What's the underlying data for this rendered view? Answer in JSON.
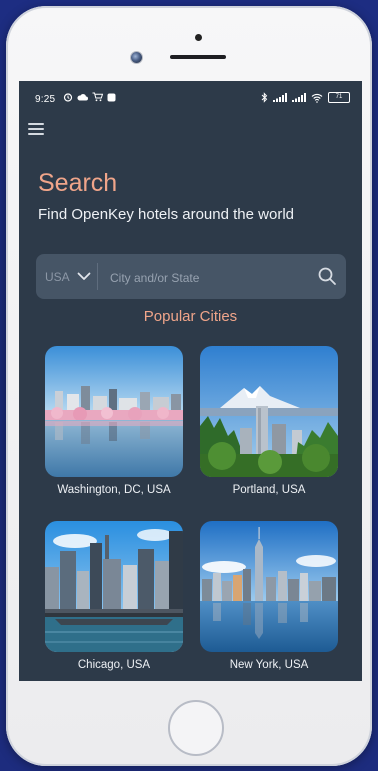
{
  "status_bar": {
    "time": "9:25",
    "battery_level": "71",
    "left_icons": [
      "alarm-icon",
      "cloud-icon",
      "cart-icon",
      "app-icon"
    ],
    "right_icons": [
      "bluetooth-icon",
      "signal-icon",
      "signal-icon",
      "wifi-icon",
      "battery-icon"
    ]
  },
  "header": {
    "menu_icon": "hamburger-menu-icon",
    "title": "Search",
    "subtitle": "Find OpenKey hotels around the world"
  },
  "search": {
    "country": "USA",
    "placeholder": "City and/or State",
    "value": "",
    "search_icon": "search-icon"
  },
  "popular": {
    "heading": "Popular Cities",
    "cities": [
      {
        "name": "Washington, DC, USA"
      },
      {
        "name": "Portland, USA"
      },
      {
        "name": "Chicago, USA"
      },
      {
        "name": "New York, USA"
      }
    ]
  },
  "colors": {
    "screen_bg": "#2d3a49",
    "accent": "#f0a58a",
    "search_bg": "#465566",
    "device_bg": "#1b2a78"
  }
}
